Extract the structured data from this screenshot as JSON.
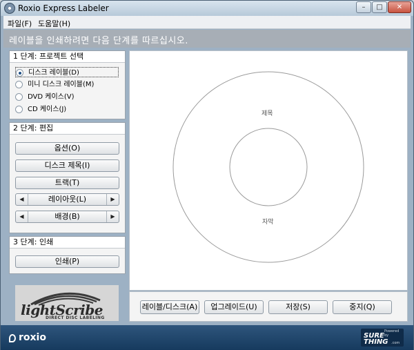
{
  "window": {
    "title": "Roxio Express Labeler",
    "min": "–",
    "max": "□",
    "close": "✕"
  },
  "menu": {
    "items": [
      "파일(F)",
      "도움말(H)"
    ]
  },
  "banner": {
    "text": "레이블을 인쇄하려면 다음 단계를 따르십시오."
  },
  "step1": {
    "title": "1 단계: 프로젝트 선택",
    "options": [
      {
        "label": "디스크 레이블(D)",
        "checked": true
      },
      {
        "label": "미니 디스크 레이블(M)",
        "checked": false
      },
      {
        "label": "DVD 케이스(V)",
        "checked": false
      },
      {
        "label": "CD 케이스(J)",
        "checked": false
      }
    ]
  },
  "step2": {
    "title": "2 단계: 편집",
    "options_button": "옵션(O)",
    "disc_title_button": "디스크 제목(I)",
    "track_button": "트랙(T)",
    "layout_label": "레이아웃(L)",
    "background_label": "배경(B)",
    "arrow_left": "◀",
    "arrow_right": "▶"
  },
  "step3": {
    "title": "3 단계: 인쇄",
    "print_button": "인쇄(P)"
  },
  "logo": {
    "name": "lightScribe",
    "tagline": "DIRECT DISC LABELING"
  },
  "canvas": {
    "title_text": "제목",
    "subtitle_text": "자막"
  },
  "actions": {
    "label_disc": "레이블/디스크(A)",
    "upgrade": "업그레이드(U)",
    "save": "저장(S)",
    "stop": "중지(Q)"
  },
  "footer": {
    "brand": "roxio",
    "partner_powered": "Powered by",
    "partner_name_1": "SURE",
    "partner_name_2": "THING",
    "partner_domain": ".com"
  },
  "colors": {
    "frame": "#9db1c4",
    "footer": "#1f4670",
    "banner": "#a7aeb6"
  }
}
